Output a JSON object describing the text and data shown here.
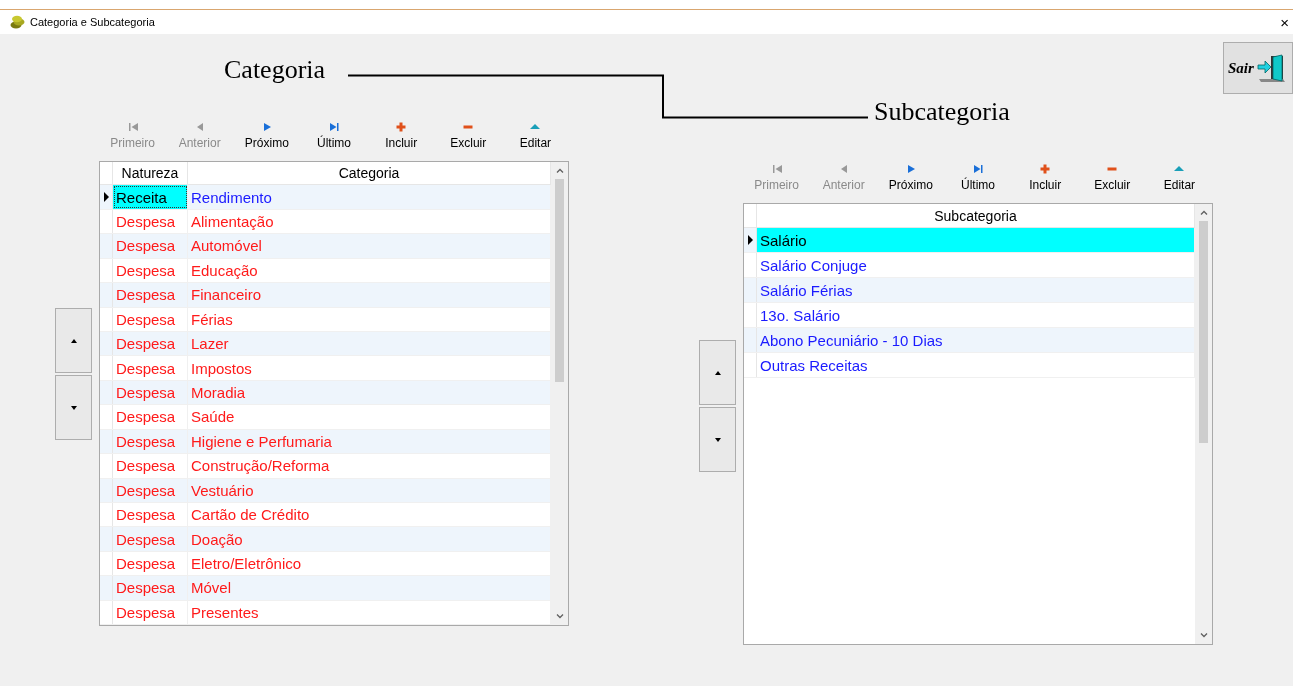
{
  "window": {
    "title": "Categoria e Subcategoria",
    "close": "×"
  },
  "labels": {
    "category": "Categoria",
    "subcategory": "Subcategoria"
  },
  "exit_button": {
    "label": "Sair"
  },
  "categories": {
    "toolbar": [
      {
        "label": "Primeiro",
        "kind": "first",
        "disabled": true
      },
      {
        "label": "Anterior",
        "kind": "prior",
        "disabled": true
      },
      {
        "label": "Próximo",
        "kind": "next",
        "disabled": false
      },
      {
        "label": "Último",
        "kind": "last",
        "disabled": false
      },
      {
        "label": "Incluir",
        "kind": "add",
        "disabled": false
      },
      {
        "label": "Excluir",
        "kind": "delete",
        "disabled": false
      },
      {
        "label": "Editar",
        "kind": "edit",
        "disabled": false
      }
    ],
    "columns": [
      "Natureza",
      "Categoria"
    ],
    "rows": [
      {
        "natureza": "Receita",
        "categoria": "Rendimento",
        "color": "#1a1aff",
        "selected": true
      },
      {
        "natureza": "Despesa",
        "categoria": "Alimentação",
        "color": "#ff1a1a",
        "selected": false
      },
      {
        "natureza": "Despesa",
        "categoria": "Automóvel",
        "color": "#ff1a1a",
        "selected": false
      },
      {
        "natureza": "Despesa",
        "categoria": "Educação",
        "color": "#ff1a1a",
        "selected": false
      },
      {
        "natureza": "Despesa",
        "categoria": "Financeiro",
        "color": "#ff1a1a",
        "selected": false
      },
      {
        "natureza": "Despesa",
        "categoria": "Férias",
        "color": "#ff1a1a",
        "selected": false
      },
      {
        "natureza": "Despesa",
        "categoria": "Lazer",
        "color": "#ff1a1a",
        "selected": false
      },
      {
        "natureza": "Despesa",
        "categoria": "Impostos",
        "color": "#ff1a1a",
        "selected": false
      },
      {
        "natureza": "Despesa",
        "categoria": "Moradia",
        "color": "#ff1a1a",
        "selected": false
      },
      {
        "natureza": "Despesa",
        "categoria": "Saúde",
        "color": "#ff1a1a",
        "selected": false
      },
      {
        "natureza": "Despesa",
        "categoria": "Higiene e Perfumaria",
        "color": "#ff1a1a",
        "selected": false
      },
      {
        "natureza": "Despesa",
        "categoria": "Construção/Reforma",
        "color": "#ff1a1a",
        "selected": false
      },
      {
        "natureza": "Despesa",
        "categoria": "Vestuário",
        "color": "#ff1a1a",
        "selected": false
      },
      {
        "natureza": "Despesa",
        "categoria": "Cartão de Crédito",
        "color": "#ff1a1a",
        "selected": false
      },
      {
        "natureza": "Despesa",
        "categoria": "Doação",
        "color": "#ff1a1a",
        "selected": false
      },
      {
        "natureza": "Despesa",
        "categoria": "Eletro/Eletrônico",
        "color": "#ff1a1a",
        "selected": false
      },
      {
        "natureza": "Despesa",
        "categoria": "Móvel",
        "color": "#ff1a1a",
        "selected": false
      },
      {
        "natureza": "Despesa",
        "categoria": "Presentes",
        "color": "#ff1a1a",
        "selected": false
      }
    ]
  },
  "subcategories": {
    "toolbar": [
      {
        "label": "Primeiro",
        "kind": "first",
        "disabled": true
      },
      {
        "label": "Anterior",
        "kind": "prior",
        "disabled": true
      },
      {
        "label": "Próximo",
        "kind": "next",
        "disabled": false
      },
      {
        "label": "Último",
        "kind": "last",
        "disabled": false
      },
      {
        "label": "Incluir",
        "kind": "add",
        "disabled": false
      },
      {
        "label": "Excluir",
        "kind": "delete",
        "disabled": false
      },
      {
        "label": "Editar",
        "kind": "edit",
        "disabled": false
      }
    ],
    "columns": [
      "Subcategoria"
    ],
    "rows": [
      {
        "name": "Salário",
        "selected": true
      },
      {
        "name": "Salário Conjuge",
        "selected": false
      },
      {
        "name": "Salário Férias",
        "selected": false
      },
      {
        "name": "13o. Salário",
        "selected": false
      },
      {
        "name": "Abono Pecuniário - 10 Dias",
        "selected": false
      },
      {
        "name": "Outras Receitas",
        "selected": false
      }
    ]
  }
}
